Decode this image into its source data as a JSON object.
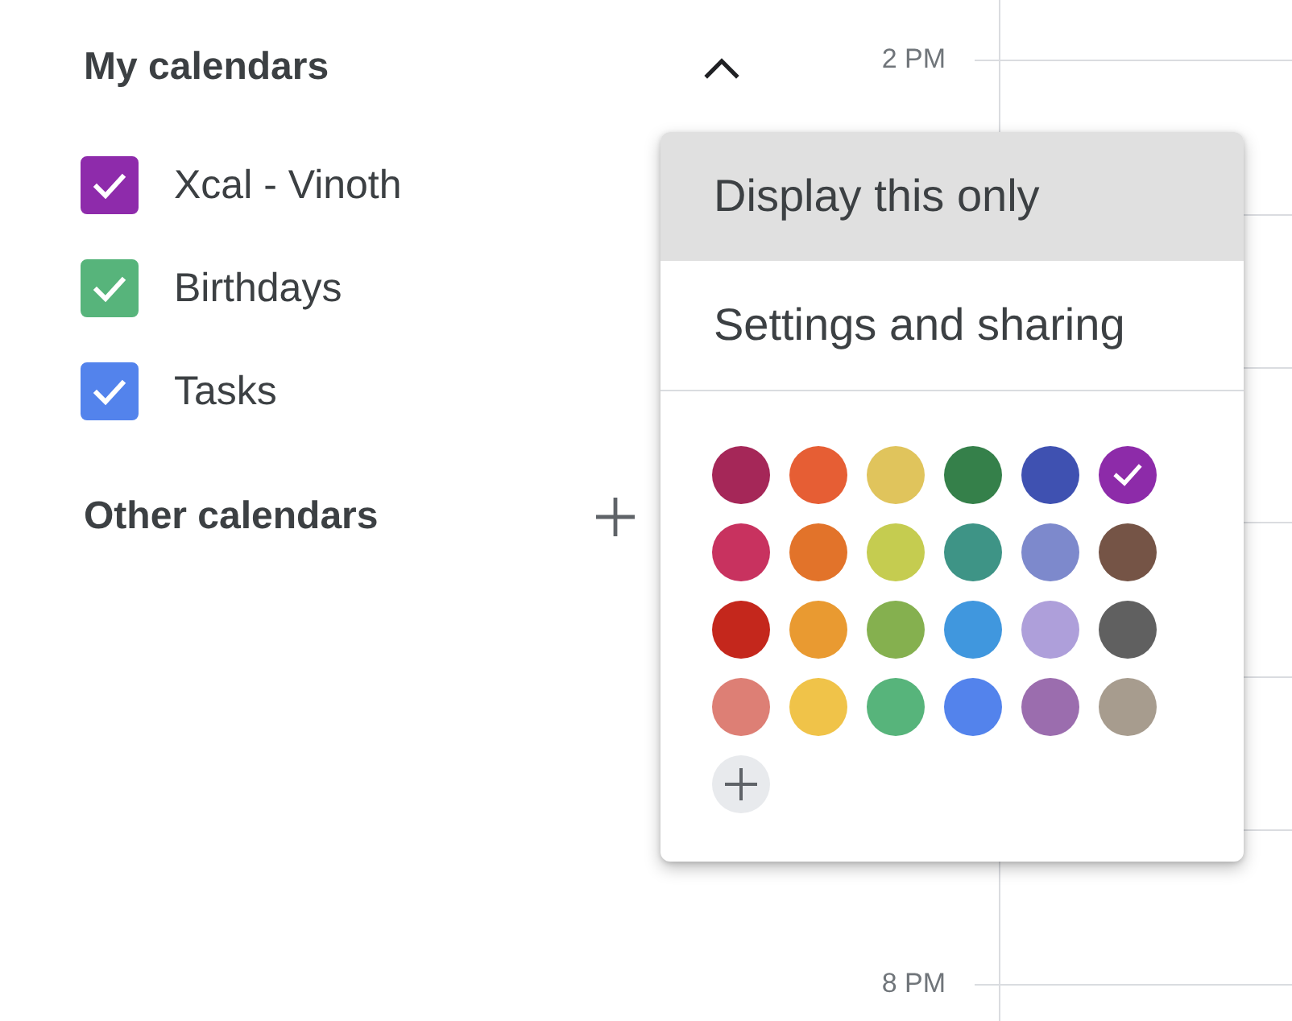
{
  "my_calendars": {
    "title": "My calendars",
    "expanded": true,
    "calendars": [
      {
        "name": "Xcal - Vinoth",
        "checked": true,
        "color": "#8e2bab"
      },
      {
        "name": "Birthdays",
        "checked": true,
        "color": "#57b47b"
      },
      {
        "name": "Tasks",
        "checked": true,
        "color": "#5383ec"
      }
    ]
  },
  "other_calendars": {
    "title": "Other calendars"
  },
  "time_labels": [
    "2 PM",
    "8 PM"
  ],
  "calendar_menu": {
    "items": [
      {
        "label": "Display this only",
        "selected": true
      },
      {
        "label": "Settings and sharing",
        "selected": false
      }
    ],
    "palette": [
      {
        "color": "#a52758",
        "selected": false
      },
      {
        "color": "#e65e34",
        "selected": false
      },
      {
        "color": "#e0c45c",
        "selected": false
      },
      {
        "color": "#35804a",
        "selected": false
      },
      {
        "color": "#3f51b1",
        "selected": false
      },
      {
        "color": "#8d2ba9",
        "selected": true
      },
      {
        "color": "#c8325f",
        "selected": false
      },
      {
        "color": "#e2732a",
        "selected": false
      },
      {
        "color": "#c5cc50",
        "selected": false
      },
      {
        "color": "#3e9486",
        "selected": false
      },
      {
        "color": "#7d89cc",
        "selected": false
      },
      {
        "color": "#755446",
        "selected": false
      },
      {
        "color": "#c4271c",
        "selected": false
      },
      {
        "color": "#e99a31",
        "selected": false
      },
      {
        "color": "#85b04f",
        "selected": false
      },
      {
        "color": "#4097de",
        "selected": false
      },
      {
        "color": "#ae9fda",
        "selected": false
      },
      {
        "color": "#606060",
        "selected": false
      },
      {
        "color": "#dd7f75",
        "selected": false
      },
      {
        "color": "#f0c349",
        "selected": false
      },
      {
        "color": "#57b47b",
        "selected": false
      },
      {
        "color": "#5383ec",
        "selected": false
      },
      {
        "color": "#9b6dae",
        "selected": false
      },
      {
        "color": "#a79c8e",
        "selected": false
      }
    ]
  }
}
